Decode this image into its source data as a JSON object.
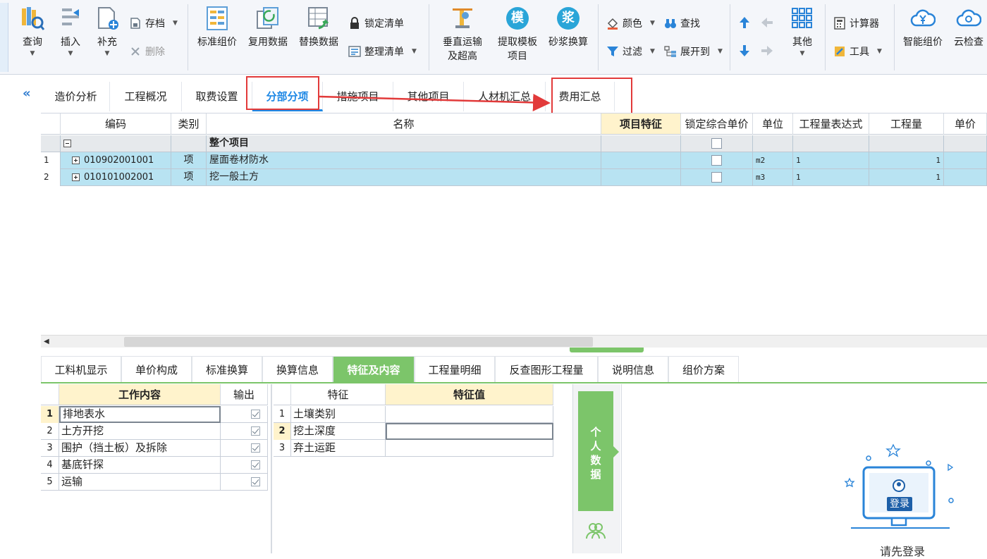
{
  "toolbar": {
    "query": "查询",
    "insert": "插入",
    "supplement": "补充",
    "archive": "存档",
    "delete": "删除",
    "standard_pricing": "标准组价",
    "reuse_data": "复用数据",
    "replace_data": "替换数据",
    "lock_list": "锁定清单",
    "organize_list": "整理清单",
    "vertical_transport": "垂直运输\n及超高",
    "extract_template": "提取模板\n项目",
    "mortar_convert": "砂浆换算",
    "color": "颜色",
    "find": "查找",
    "filter": "过滤",
    "expand": "展开到",
    "other": "其他",
    "calculator": "计算器",
    "tools": "工具",
    "smart_pricing": "智能组价",
    "cloud_check": "云检查",
    "template_glyph": "模",
    "mortar_glyph": "浆"
  },
  "main_tabs": [
    {
      "label": "造价分析"
    },
    {
      "label": "工程概况"
    },
    {
      "label": "取费设置"
    },
    {
      "label": "分部分项"
    },
    {
      "label": "措施项目"
    },
    {
      "label": "其他项目"
    },
    {
      "label": "人材机汇总"
    },
    {
      "label": "费用汇总"
    }
  ],
  "grid": {
    "headers": [
      "编码",
      "类别",
      "名称",
      "项目特征",
      "锁定综合单价",
      "单位",
      "工程量表达式",
      "工程量",
      "单价"
    ],
    "group_row": {
      "name": "整个项目"
    },
    "rows": [
      {
        "index": "1",
        "code": "010902001001",
        "type": "项",
        "name": "屋面卷材防水",
        "unit": "m2",
        "expr": "1",
        "qty": "1"
      },
      {
        "index": "2",
        "code": "010101002001",
        "type": "项",
        "name": "挖一般土方",
        "unit": "m3",
        "expr": "1",
        "qty": "1"
      }
    ]
  },
  "sub_tabs": [
    {
      "label": "工料机显示"
    },
    {
      "label": "单价构成"
    },
    {
      "label": "标准换算"
    },
    {
      "label": "换算信息"
    },
    {
      "label": "特征及内容"
    },
    {
      "label": "工程量明细"
    },
    {
      "label": "反查图形工程量"
    },
    {
      "label": "说明信息"
    },
    {
      "label": "组价方案"
    }
  ],
  "work_content": {
    "header_name": "工作内容",
    "header_output": "输出",
    "items": [
      {
        "index": "1",
        "name": "排地表水",
        "checked": true
      },
      {
        "index": "2",
        "name": "土方开挖",
        "checked": true
      },
      {
        "index": "3",
        "name": "围护（挡土板）及拆除",
        "checked": true
      },
      {
        "index": "4",
        "name": "基底钎探",
        "checked": true
      },
      {
        "index": "5",
        "name": "运输",
        "checked": true
      }
    ]
  },
  "features": {
    "header_feature": "特征",
    "header_value": "特征值",
    "items": [
      {
        "index": "1",
        "name": "土壤类别",
        "value": ""
      },
      {
        "index": "2",
        "name": "挖土深度",
        "value": ""
      },
      {
        "index": "3",
        "name": "弃土运距",
        "value": ""
      }
    ]
  },
  "side_panel": {
    "personal_data": "个人数据",
    "login_button": "登录",
    "login_prompt": "请先登录"
  },
  "colors": {
    "accent_blue": "#1e88e5",
    "selected_row": "#b8e3f2",
    "header_highlight": "#fff3cc",
    "green": "#7cc56a",
    "annotation_red": "#e23a3a"
  }
}
